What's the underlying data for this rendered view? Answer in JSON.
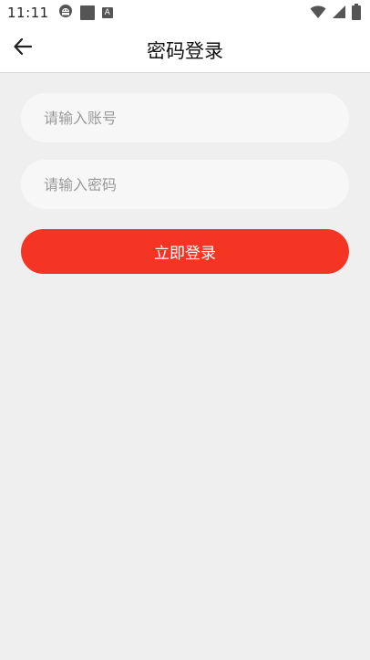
{
  "status_bar": {
    "time": "11:11",
    "left_icons": [
      "android-debug-icon",
      "square-icon",
      "a-icon"
    ],
    "right_icons": [
      "wifi-icon",
      "signal-icon",
      "battery-icon"
    ]
  },
  "header": {
    "title": "密码登录",
    "back_icon": "arrow-left-icon"
  },
  "form": {
    "account_placeholder": "请输入账号",
    "account_value": "",
    "password_placeholder": "请输入密码",
    "password_value": "",
    "submit_label": "立即登录"
  },
  "colors": {
    "accent": "#f43523",
    "background": "#efefef",
    "field_background": "#f7f7f7"
  }
}
